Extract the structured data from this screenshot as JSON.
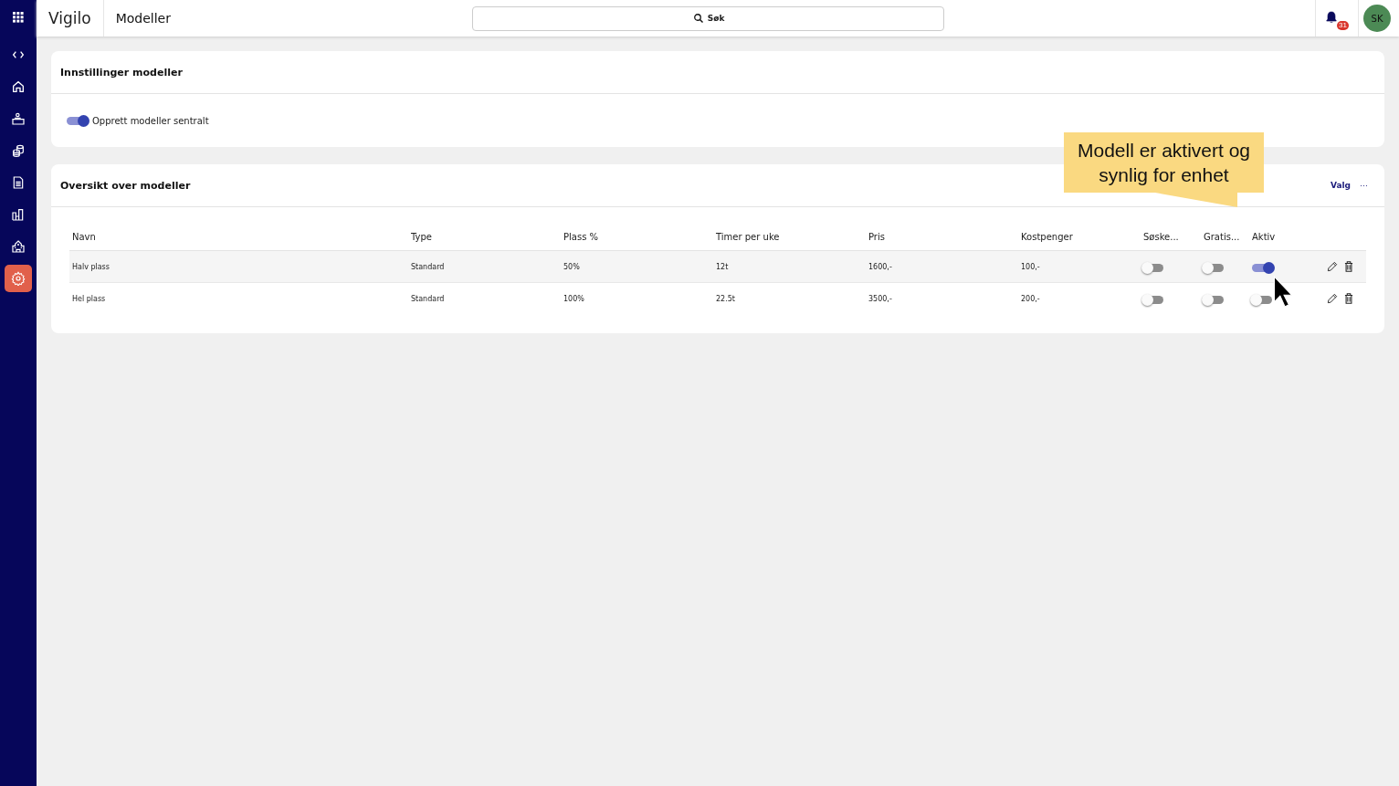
{
  "topbar": {
    "brand": "Vigilo",
    "page_title": "Modeller",
    "search": {
      "placeholder": "Søk"
    },
    "notifications": "31",
    "avatar": "SK"
  },
  "sidebar": {
    "items": [
      {
        "selected": false
      },
      {
        "selected": false
      },
      {
        "selected": false
      },
      {
        "selected": false
      },
      {
        "selected": false
      },
      {
        "selected": false
      },
      {
        "selected": false
      },
      {
        "selected": true
      }
    ]
  },
  "settings_card": {
    "title": "Innstillinger modeller",
    "toggle": {
      "label": "Opprett modeller sentralt",
      "on": true
    }
  },
  "overview_card": {
    "title": "Oversikt over modeller",
    "menu_label": "Valg",
    "menu_icon": "···",
    "table": {
      "columns": [
        "Navn",
        "Type",
        "Plass %",
        "Timer per uke",
        "Pris",
        "Kostpenger",
        "Søske...",
        "Gratis...",
        "Aktiv"
      ],
      "rows": [
        {
          "name": "Halv plass",
          "type": "Standard",
          "share": "50%",
          "hours": "12t",
          "price": "1600,-",
          "food": "100,-",
          "sibling": false,
          "free": false,
          "active": true
        },
        {
          "name": "Hel plass",
          "type": "Standard",
          "share": "100%",
          "hours": "22.5t",
          "price": "3500,-",
          "food": "200,-",
          "sibling": false,
          "free": false,
          "active": false
        }
      ]
    }
  },
  "callout": {
    "text": "Modell er aktivert og synlig for enhet"
  }
}
